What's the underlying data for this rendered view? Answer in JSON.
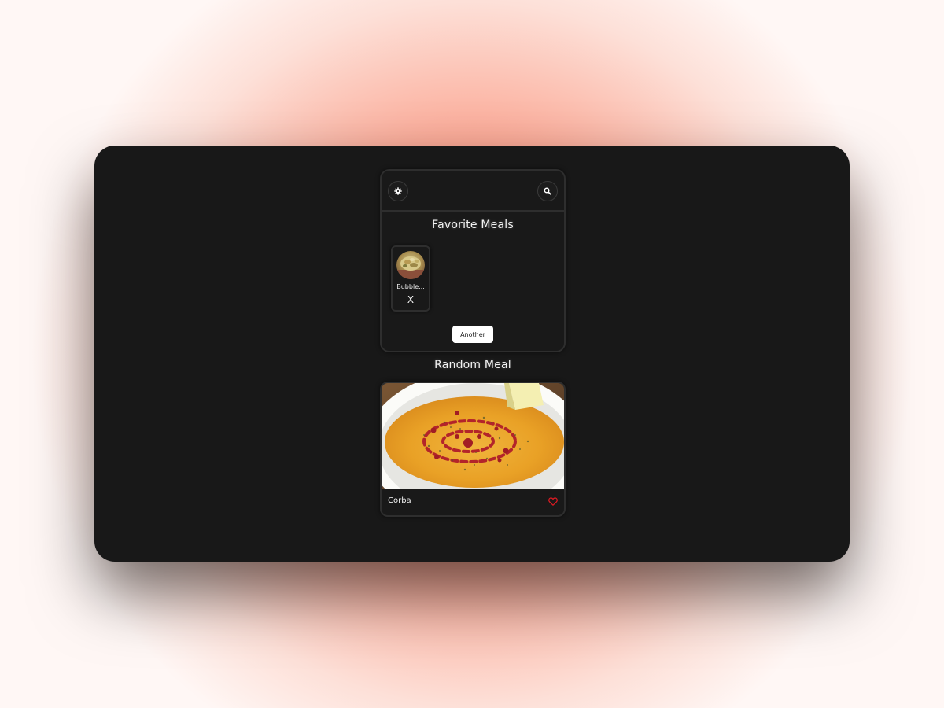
{
  "header": {
    "settings_icon": "gear-icon",
    "search_icon": "search-icon"
  },
  "favorites": {
    "title": "Favorite Meals",
    "items": [
      {
        "name": "Bubble...",
        "remove_label": "X",
        "thumb_icon": "meal-photo"
      }
    ],
    "another_label": "Another"
  },
  "random": {
    "title": "Random Meal",
    "meal_name": "Corba",
    "favorite_icon": "heart-icon"
  },
  "colors": {
    "frame_background": "#181818",
    "accent_heart": "#e31b23",
    "text": "#f2f2f2",
    "page_glow": "#fa8a72"
  }
}
